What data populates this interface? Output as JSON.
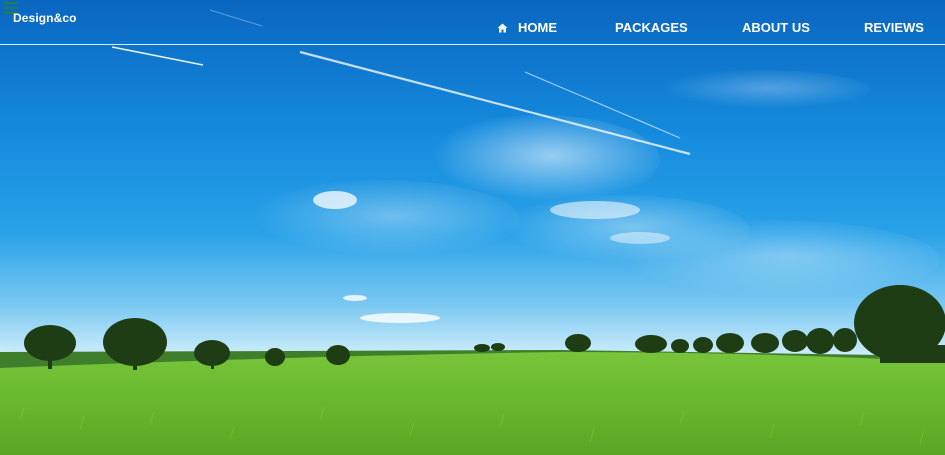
{
  "header": {
    "brand": "Design&co",
    "menu_icon": "hamburger-menu-icon"
  },
  "nav": {
    "home": {
      "label": "HOME",
      "icon": "home-icon"
    },
    "packages": {
      "label": "PACKAGES"
    },
    "about": {
      "label": "ABOUT US"
    },
    "reviews": {
      "label": "REVIEWS"
    }
  },
  "colors": {
    "sky_top": "#0a67c2",
    "sky_mid": "#1590e2",
    "horizon": "#bfe6f8",
    "field_far": "#4c8a34",
    "field_near": "#7bc83a",
    "menu_icon": "#1f7f4f"
  }
}
